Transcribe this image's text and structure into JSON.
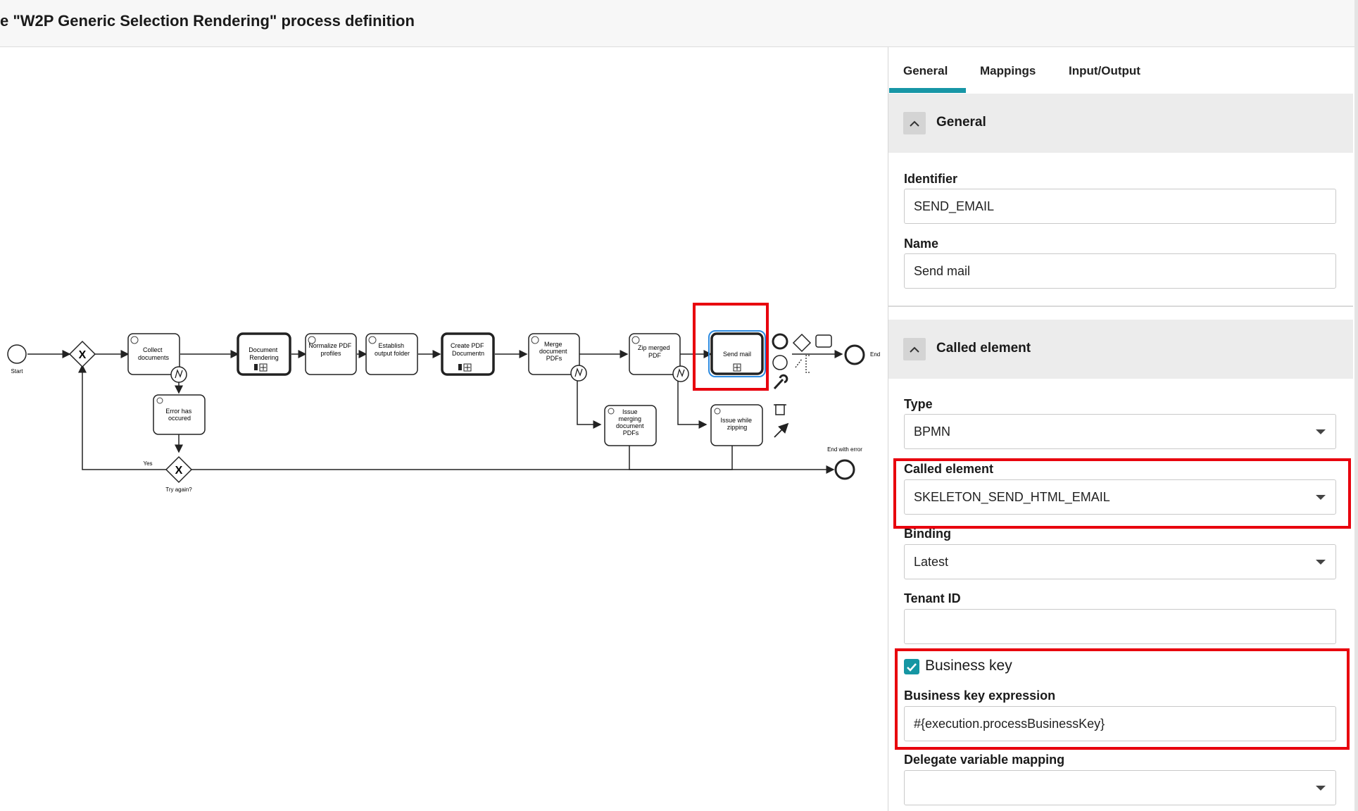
{
  "header": {
    "title": "e \"W2P Generic Selection Rendering\" process definition"
  },
  "tabs": [
    {
      "label": "General"
    },
    {
      "label": "Mappings"
    },
    {
      "label": "Input/Output"
    }
  ],
  "sections": {
    "general": {
      "title": "General"
    },
    "called": {
      "title": "Called element"
    }
  },
  "fields": {
    "identifier": {
      "label": "Identifier",
      "value": "SEND_EMAIL"
    },
    "name": {
      "label": "Name",
      "value": "Send mail"
    },
    "type": {
      "label": "Type",
      "value": "BPMN"
    },
    "called_element": {
      "label": "Called element",
      "value": "SKELETON_SEND_HTML_EMAIL"
    },
    "binding": {
      "label": "Binding",
      "value": "Latest"
    },
    "tenant_id": {
      "label": "Tenant ID",
      "value": ""
    },
    "business_key": {
      "label": "Business key",
      "checked": true
    },
    "business_key_expression": {
      "label": "Business key expression",
      "value": "#{execution.processBusinessKey}"
    },
    "delegate_variable_mapping": {
      "label": "Delegate variable mapping",
      "value": ""
    }
  },
  "diagram": {
    "start": "Start",
    "collect": [
      "Collect",
      "documents"
    ],
    "doc_rendering": [
      "Document",
      "Rendering"
    ],
    "normalize": [
      "Normalize PDF",
      "profiles"
    ],
    "establish": [
      "Establish",
      "output folder"
    ],
    "create_pdf": [
      "Create PDF",
      "Documentn"
    ],
    "merge": [
      "Merge",
      "document",
      "PDFs"
    ],
    "zip": [
      "Zip merged",
      "PDF"
    ],
    "send_mail": [
      "Send mail"
    ],
    "end": "End",
    "error_occurred": [
      "Error has",
      "occured"
    ],
    "issue_merging": [
      "Issue",
      "merging",
      "document",
      "PDFs"
    ],
    "issue_zipping": [
      "Issue while",
      "zipping"
    ],
    "yes": "Yes",
    "try_again": "Try again?",
    "end_with_error": "End with error"
  },
  "colors": {
    "accent": "#1796a6",
    "highlight": "#e8000d",
    "selected": "#2d8be0"
  }
}
